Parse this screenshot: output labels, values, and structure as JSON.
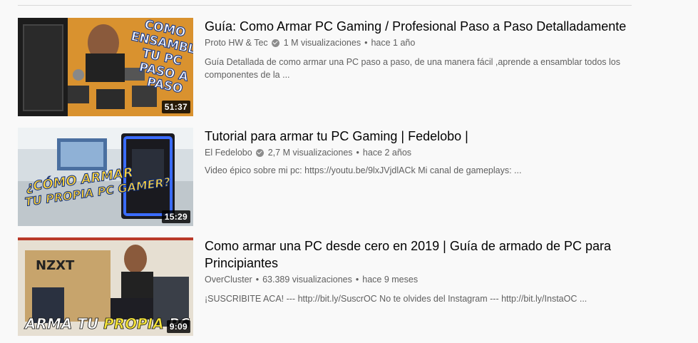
{
  "colors": {
    "background": "#f9f9f9",
    "title": "#030303",
    "meta": "#606060",
    "duration_bg": "#000000"
  },
  "results": [
    {
      "title": "Guía: Como Armar PC Gaming / Profesional Paso a Paso Detalladamente",
      "channel": "Proto HW & Tec",
      "verified": true,
      "views": "1 M visualizaciones",
      "age": "hace 1 año",
      "description": "Guía Detallada de como armar una PC paso a paso, de una manera fácil ,aprende a ensamblar todos los componentes de la ...",
      "duration": "51:37",
      "thumbnail_text": "COMO ENSAMBLAR TU PC PASO A PASO"
    },
    {
      "title": "Tutorial para armar tu PC Gaming | Fedelobo |",
      "channel": "El Fedelobo",
      "verified": true,
      "views": "2,7 M visualizaciones",
      "age": "hace 2 años",
      "description": "Video épico sobre mi pc: https://youtu.be/9lxJVjdlACk Mi canal de gameplays: ...",
      "duration": "15:29",
      "thumbnail_text": "¿CÓMO ARMAR TU PROPIA PC GAMER?"
    },
    {
      "title": "Como armar una PC desde cero en 2019 | Guía de armado de PC para Principiantes",
      "channel": "OverCluster",
      "verified": false,
      "views": "63.389 visualizaciones",
      "age": "hace 9 meses",
      "description": "¡SUSCRIBITE ACA! --- http://bit.ly/SuscrOC No te olvides del Instagram --- http://bit.ly/InstaOC ...",
      "duration": "9:09",
      "thumbnail_text": "ARMA TU PROPIA PC"
    }
  ],
  "separator": "•"
}
